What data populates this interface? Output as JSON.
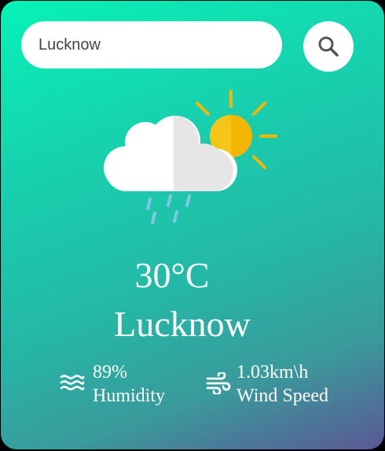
{
  "search": {
    "value": "Lucknow",
    "icon": "search-icon"
  },
  "weather": {
    "condition_icon": "rain-sun-cloud-icon",
    "temperature": "30°C",
    "city": "Lucknow"
  },
  "details": {
    "humidity": {
      "icon": "humidity-waves-icon",
      "value": "89%",
      "label": "Humidity"
    },
    "wind": {
      "icon": "wind-icon",
      "value": "1.03km\\h",
      "label": "Wind Speed"
    }
  },
  "colors": {
    "gradient_start": "#06f2b7",
    "gradient_end": "#5b5895",
    "sun": "#f5c518",
    "sun_rays": "#f2b705",
    "cloud": "#ffffff",
    "cloud_shade": "#e6e6e6",
    "rain": "#7ec8e3"
  }
}
